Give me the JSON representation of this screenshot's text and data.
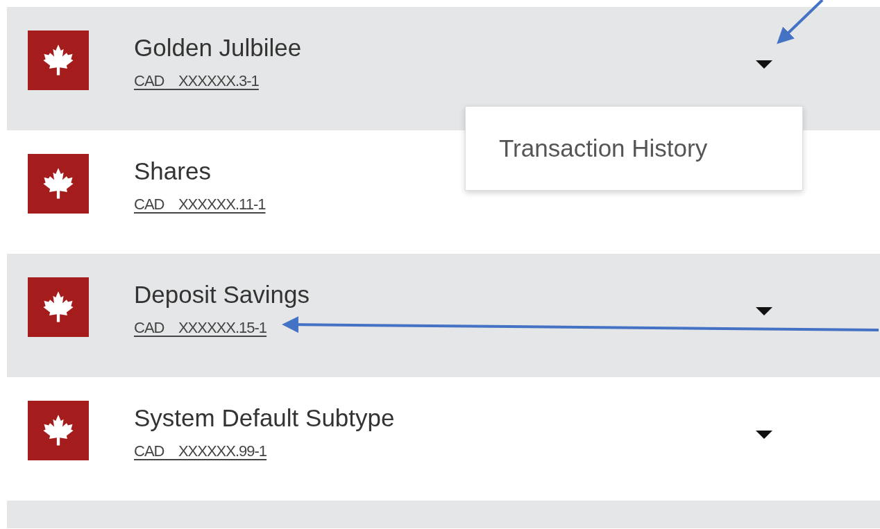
{
  "accounts": [
    {
      "name": "Golden Julbilee",
      "currency": "CAD",
      "number": "XXXXXX.3-1",
      "expanded": true,
      "menu": [
        "Transaction History"
      ],
      "arrow_at_caret": true,
      "arrow_at_number": false
    },
    {
      "name": "Shares",
      "currency": "CAD",
      "number": "XXXXXX.11-1",
      "expanded": false,
      "arrow_at_caret": false,
      "arrow_at_number": false
    },
    {
      "name": "Deposit Savings",
      "currency": "CAD",
      "number": "XXXXXX.15-1",
      "expanded": false,
      "arrow_at_caret": false,
      "arrow_at_number": true
    },
    {
      "name": "System Default Subtype",
      "currency": "CAD",
      "number": "XXXXXX.99-1",
      "expanded": false,
      "arrow_at_caret": false,
      "arrow_at_number": false
    }
  ]
}
